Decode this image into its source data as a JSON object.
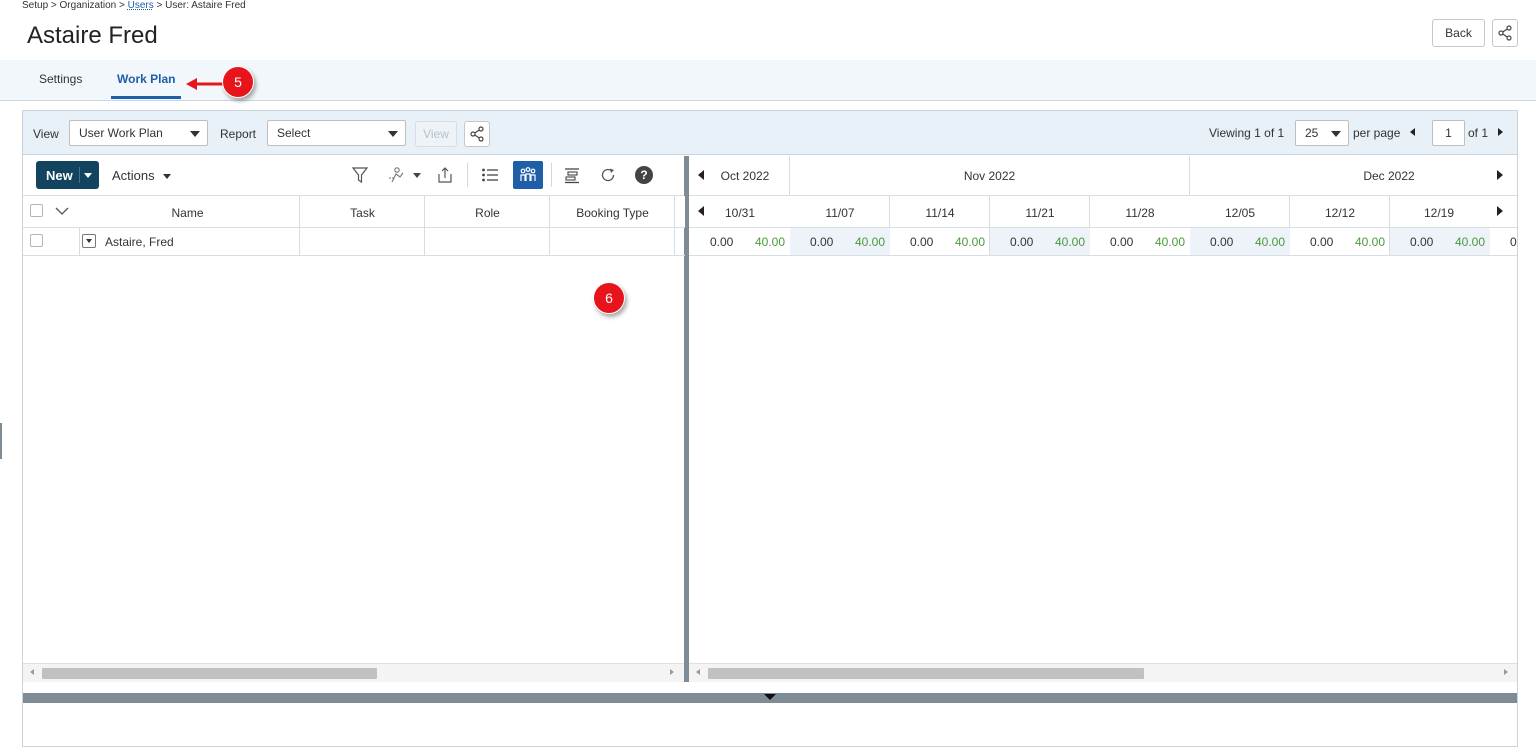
{
  "breadcrumb": {
    "part1": "Setup > Organization > ",
    "link": "Users",
    "part2": " > User: Astaire Fred"
  },
  "page_title": "Astaire Fred",
  "header": {
    "back_label": "Back"
  },
  "tabs": [
    {
      "label": "Settings"
    },
    {
      "label": "Work Plan",
      "active": true
    }
  ],
  "annotations": {
    "badge_5": "5",
    "badge_6": "6"
  },
  "toolbar": {
    "view_label": "View",
    "view_select": "User Work Plan",
    "report_label": "Report",
    "report_select": "Select",
    "view_button": "View",
    "viewing_prefix": "Viewing",
    "viewing_range": "1 of 1",
    "per_page_value": "25",
    "per_page_label": "per page",
    "page_input": "1",
    "page_total": "of 1"
  },
  "grid_toolbar": {
    "new_label": "New",
    "actions_label": "Actions",
    "help_glyph": "?"
  },
  "grid": {
    "columns": [
      "Name",
      "Task",
      "Role",
      "Booking Type"
    ],
    "rows": [
      {
        "name": "Astaire, Fred",
        "task": "",
        "role": "",
        "booking_type": ""
      }
    ]
  },
  "gantt": {
    "months": [
      "Oct 2022",
      "Nov 2022",
      "Dec 2022"
    ],
    "weeks": [
      "10/31",
      "11/07",
      "11/14",
      "11/21",
      "11/28",
      "12/05",
      "12/12",
      "12/19"
    ],
    "values": [
      {
        "a": "0.00",
        "c": "40.00"
      },
      {
        "a": "0.00",
        "c": "40.00"
      },
      {
        "a": "0.00",
        "c": "40.00"
      },
      {
        "a": "0.00",
        "c": "40.00"
      },
      {
        "a": "0.00",
        "c": "40.00"
      },
      {
        "a": "0.00",
        "c": "40.00"
      },
      {
        "a": "0.00",
        "c": "40.00"
      },
      {
        "a": "0.00",
        "c": "40.00"
      }
    ],
    "trailing_value": "0"
  },
  "colors": {
    "accent": "#1f5ea8",
    "new_button": "#12435f",
    "badge": "#e8141b",
    "capacity_green": "#4a9a3a"
  },
  "icons": [
    "share-icon",
    "filter-icon",
    "assign-icon",
    "export-icon",
    "list-view-icon",
    "gantt-view-icon",
    "settings-icon",
    "refresh-icon",
    "help-icon"
  ]
}
